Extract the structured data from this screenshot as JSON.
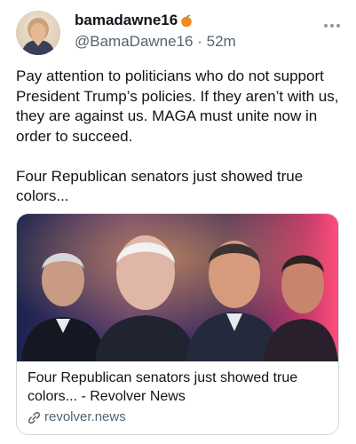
{
  "tweet": {
    "display_name": "bamadawne16",
    "display_emoji": "peach-icon",
    "handle": "@BamaDawne16",
    "separator": "·",
    "time": "52m",
    "text": "Pay attention to politicians who do not support President Trump’s policies.  If they aren’t with us, they are against us.  MAGA must unite now in order to succeed.\n\nFour Republican senators just showed true colors..."
  },
  "card": {
    "title": "Four Republican senators just showed true colors... - Revolver News",
    "domain": "revolver.news",
    "domain_icon": "link-icon"
  },
  "colors": {
    "text": "#0f1419",
    "secondary": "#536471",
    "border": "#cfd9de",
    "peach": "#f08a24"
  }
}
